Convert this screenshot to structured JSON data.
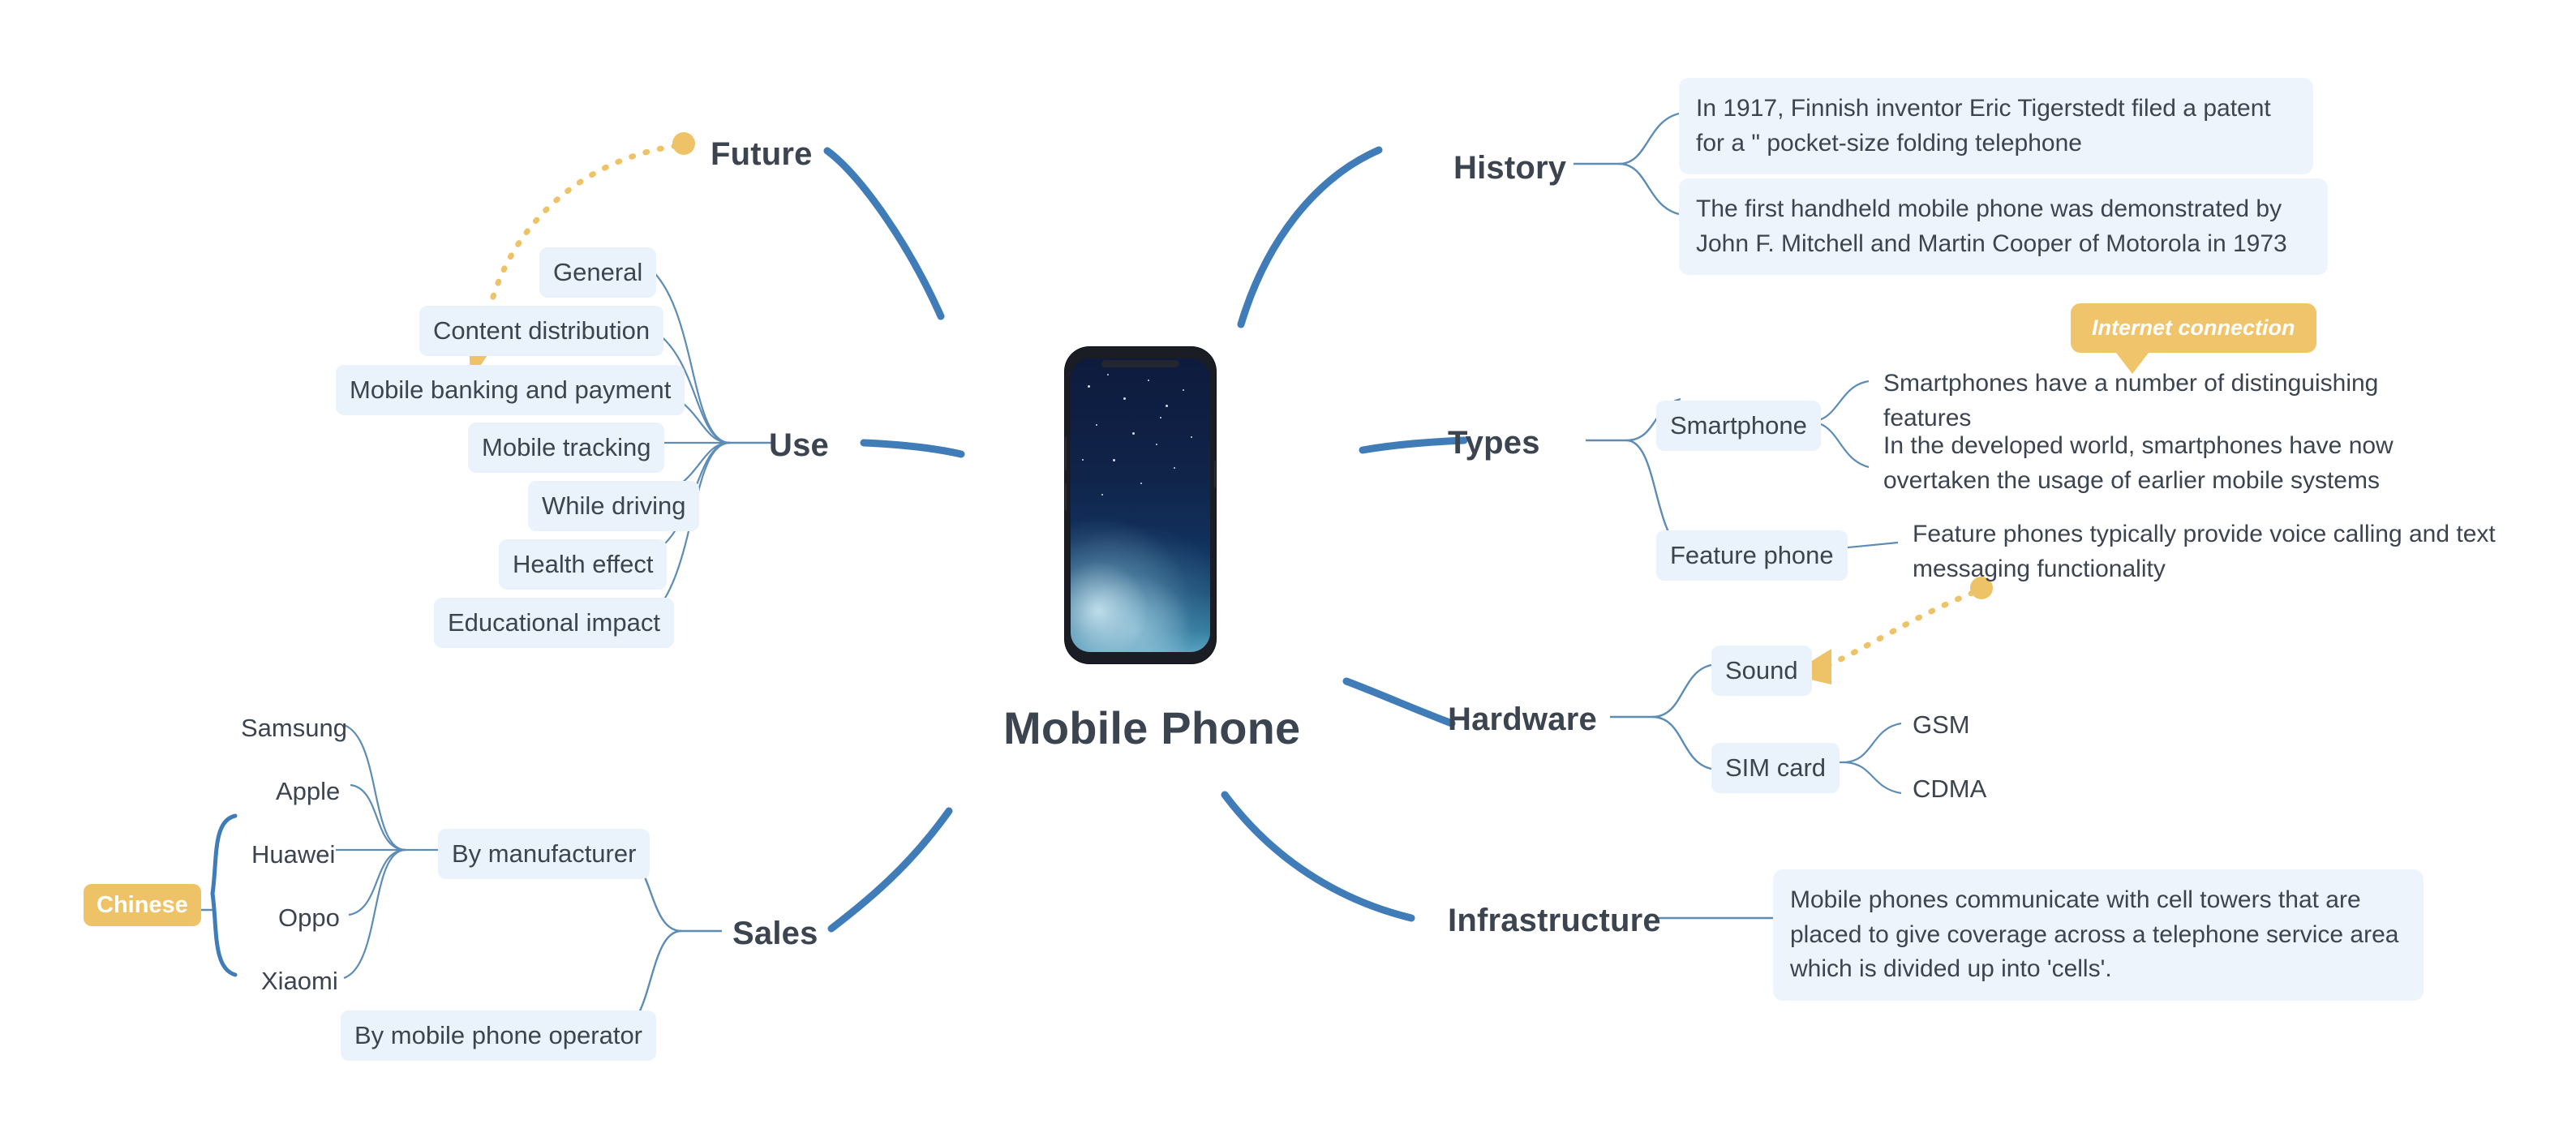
{
  "center": {
    "title": "Mobile Phone",
    "image_name": "smartphone-photo"
  },
  "branches": {
    "history": {
      "label": "History",
      "details": [
        "In 1917, Finnish inventor Eric Tigerstedt filed a patent for a \" pocket-size folding telephone",
        "The first handheld  mobile phone was demonstrated by John F. Mitchell and Martin Cooper of Motorola in 1973"
      ]
    },
    "types": {
      "label": "Types",
      "children": [
        {
          "label": "Smartphone",
          "details": [
            "Smartphones have a number of distinguishing features",
            "In the developed world, smartphones have now overtaken the usage of earlier mobile systems"
          ]
        },
        {
          "label": "Feature phone",
          "details": [
            "Feature phones typically provide voice calling and text messaging functionality"
          ]
        }
      ],
      "callout": "Internet connection"
    },
    "hardware": {
      "label": "Hardware",
      "children": [
        {
          "label": "Sound",
          "details": []
        },
        {
          "label": "SIM card",
          "details": [
            "GSM",
            "CDMA"
          ]
        }
      ]
    },
    "infrastructure": {
      "label": "Infrastructure",
      "details": [
        "Mobile phones communicate with cell towers that are placed to give coverage across a telephone service area which is divided up into 'cells'."
      ]
    },
    "future": {
      "label": "Future"
    },
    "use": {
      "label": "Use",
      "children": [
        "General",
        "Content distribution",
        "Mobile banking and payment",
        "Mobile tracking",
        "While driving",
        "Health effect",
        "Educational impact"
      ]
    },
    "sales": {
      "label": "Sales",
      "children": [
        {
          "label": "By manufacturer",
          "brands": [
            "Samsung",
            "Apple",
            "Huawei",
            "Oppo",
            "Xiaomi"
          ],
          "group_tag": "Chinese"
        },
        {
          "label": "By mobile phone operator",
          "brands": []
        }
      ]
    }
  },
  "colors": {
    "trunk_blue": "#3f7cb8",
    "wire_blue": "#5d8cb5",
    "chip_blue": "#eaf2fb",
    "paragraph_blue": "#eef4fc",
    "accent_yellow": "#eec267",
    "text_dark": "#3c4450"
  }
}
